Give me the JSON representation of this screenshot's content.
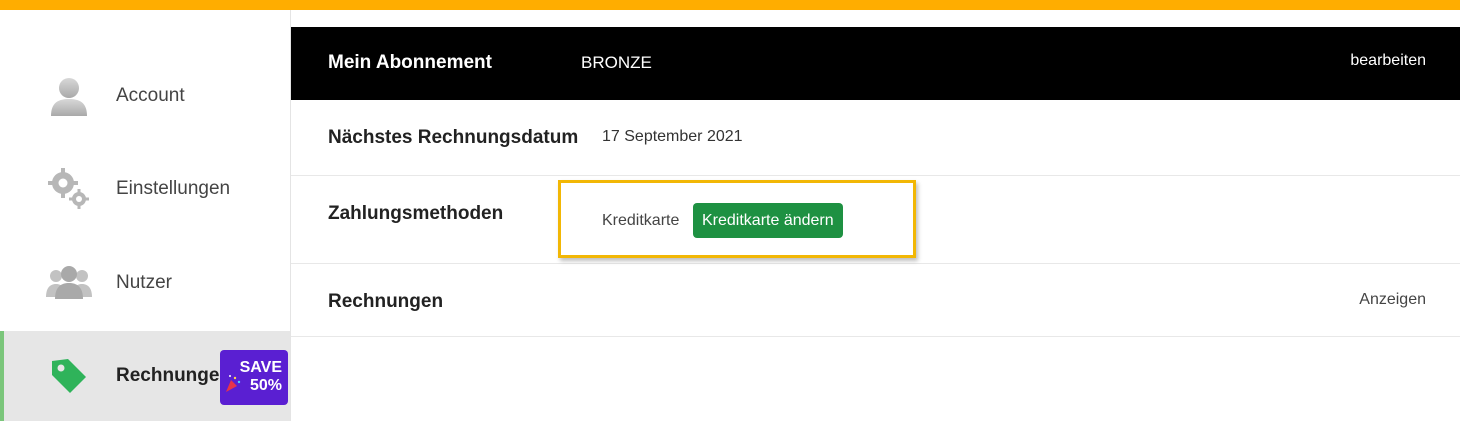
{
  "colors": {
    "topbar": "#ffad00",
    "header_bg": "#000000",
    "button_green": "#1e9142",
    "highlight": "#f2b705",
    "promo_bg": "#5a1fd2",
    "tag_green": "#2fb35a",
    "active_bar": "#7bc67b"
  },
  "sidebar": {
    "items": [
      {
        "label": "Account",
        "icon": "user-icon"
      },
      {
        "label": "Einstellungen",
        "icon": "gears-icon"
      },
      {
        "label": "Nutzer",
        "icon": "users-icon"
      },
      {
        "label": "Rechnungen",
        "icon": "tag-icon",
        "active": true
      }
    ],
    "promo": {
      "line1": "SAVE",
      "line2": "50%",
      "icon": "party-popper-icon"
    }
  },
  "header": {
    "title": "Mein Abonnement",
    "plan": "BRONZE",
    "edit_label": "bearbeiten"
  },
  "rows": {
    "billing_date": {
      "label": "Nächstes Rechnungsdatum",
      "value": "17 September 2021"
    },
    "payment": {
      "label": "Zahlungsmethoden",
      "method": "Kreditkarte",
      "button_label": "Kreditkarte ändern"
    },
    "invoices": {
      "label": "Rechnungen",
      "action": "Anzeigen"
    }
  }
}
